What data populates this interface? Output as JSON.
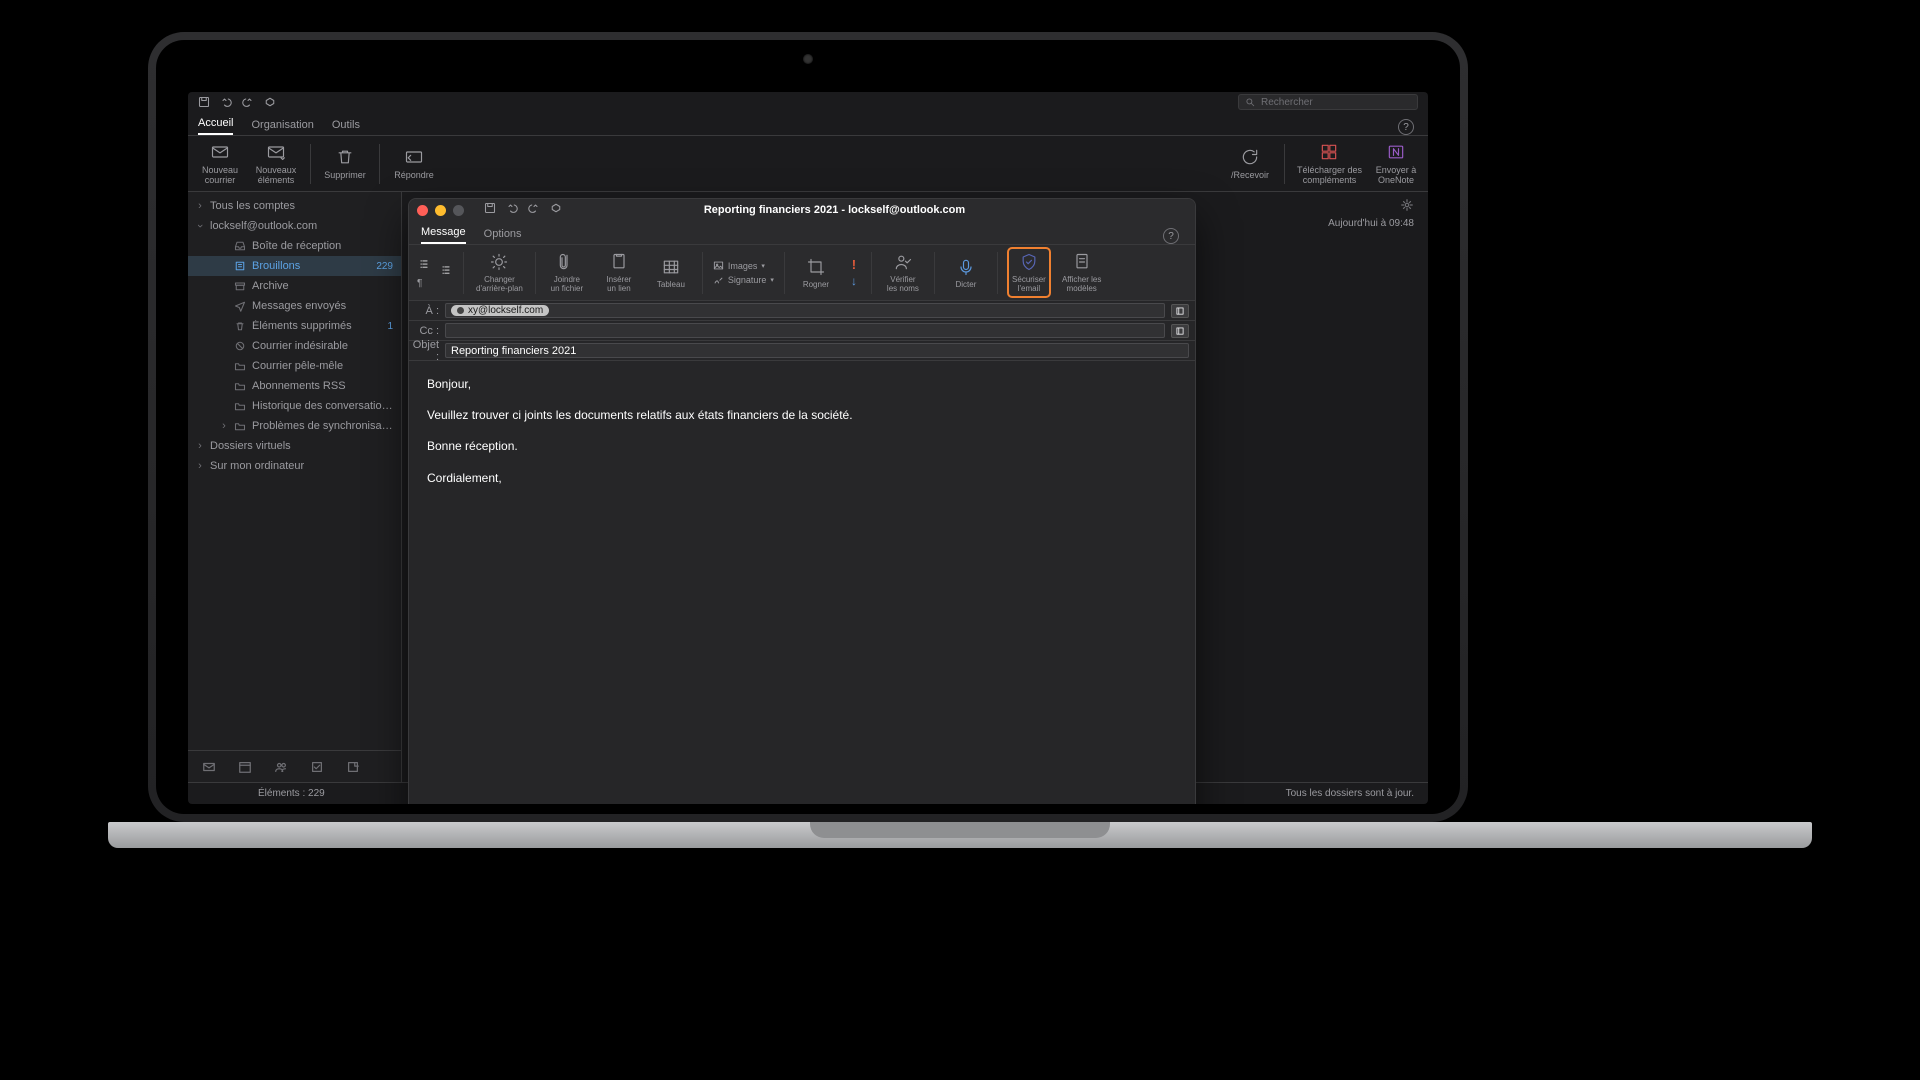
{
  "main": {
    "search_placeholder": "Rechercher",
    "tabs": [
      "Accueil",
      "Organisation",
      "Outils"
    ],
    "ribbon": {
      "nouveau_courrier": "Nouveau\ncourrier",
      "nouveaux_elements": "Nouveaux\néléments",
      "supprimer": "Supprimer",
      "repondre": "Répondre",
      "recevoir": "/Recevoir",
      "telecharger": "Télécharger des\ncompléments",
      "onenote": "Envoyer à\nOneNote"
    },
    "status_left": "Éléments : 229",
    "status_right": "Tous les dossiers sont à jour.",
    "content_time": "Aujourd'hui à 09:48"
  },
  "sidebar": {
    "all_accounts": "Tous les comptes",
    "account": "lockself@outlook.com",
    "folders": [
      {
        "id": "inbox",
        "label": "Boîte de réception",
        "icon": "inbox",
        "count": ""
      },
      {
        "id": "drafts",
        "label": "Brouillons",
        "icon": "draft",
        "count": "229",
        "selected": true
      },
      {
        "id": "archive",
        "label": "Archive",
        "icon": "archive",
        "count": ""
      },
      {
        "id": "sent",
        "label": "Messages envoyés",
        "icon": "sent",
        "count": ""
      },
      {
        "id": "deleted",
        "label": "Éléments supprimés",
        "icon": "trash",
        "count": "1"
      },
      {
        "id": "junk",
        "label": "Courrier indésirable",
        "icon": "junk",
        "count": ""
      },
      {
        "id": "clutter",
        "label": "Courrier pêle-mêle",
        "icon": "folder",
        "count": ""
      },
      {
        "id": "rss",
        "label": "Abonnements RSS",
        "icon": "folder",
        "count": ""
      },
      {
        "id": "history",
        "label": "Historique des conversations",
        "icon": "folder",
        "count": ""
      },
      {
        "id": "sync",
        "label": "Problèmes de synchronisation",
        "icon": "folder",
        "count": "",
        "chev": true
      }
    ],
    "virtual": "Dossiers virtuels",
    "computer": "Sur mon ordinateur"
  },
  "compose": {
    "title": "Reporting financiers 2021 - lockself@outlook.com",
    "tabs": [
      "Message",
      "Options"
    ],
    "ribbon": {
      "changer_bg": "Changer\nd'arrière-plan",
      "joindre_fichier": "Joindre\nun fichier",
      "inserer_lien": "Insérer\nun lien",
      "tableau": "Tableau",
      "images": "Images",
      "signature": "Signature",
      "rogner": "Rogner",
      "verifier_noms": "Vérifier\nles noms",
      "dicter": "Dicter",
      "securiser": "Sécuriser\nl'email",
      "afficher_modeles": "Afficher les\nmodèles"
    },
    "fields": {
      "to_label": "À :",
      "to_chip": "xy@lockself.com",
      "cc_label": "Cc :",
      "subject_label": "Objet :",
      "subject_value": "Reporting financiers 2021"
    },
    "body": {
      "p1": "Bonjour,",
      "p2": "Veuillez trouver ci joints les documents relatifs aux états financiers de la société.",
      "p3": "Bonne réception.",
      "p4": "Cordialement,"
    }
  }
}
